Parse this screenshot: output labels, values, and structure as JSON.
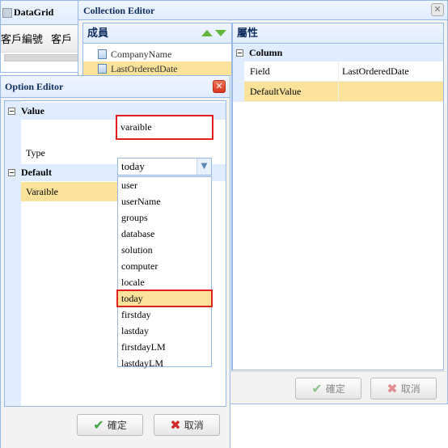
{
  "datagrid": {
    "title": "DataGrid",
    "columns": [
      "客戶編號",
      "客戶"
    ]
  },
  "collection_editor": {
    "title": "Collection Editor",
    "members_header": "成員",
    "members": [
      "CompanyName",
      "LastOrderedDate"
    ],
    "selected_member": "LastOrderedDate",
    "props_header": "屬性",
    "group": "Column",
    "rows": [
      {
        "key": "Field",
        "value": "LastOrderedDate"
      },
      {
        "key": "DefaultValue",
        "value": ""
      }
    ],
    "ok_label": "確定",
    "cancel_label": "取消"
  },
  "option_editor": {
    "title": "Option Editor",
    "group_value": "Value",
    "type_label": "Type",
    "type_value": "varaible",
    "group_default": "Default",
    "variable_label": "Varaible",
    "variable_value": "today",
    "options": [
      "user",
      "userName",
      "groups",
      "database",
      "solution",
      "computer",
      "locale",
      "today",
      "firstday",
      "lastday",
      "firstdayLM",
      "lastdayLM"
    ],
    "selected_option": "today",
    "ok_label": "確定",
    "cancel_label": "取消"
  },
  "colors": {
    "header_blue": "#e0ecff",
    "border_blue": "#95b8e7",
    "highlight": "#fbe29a",
    "red_outline": "#e02020"
  }
}
